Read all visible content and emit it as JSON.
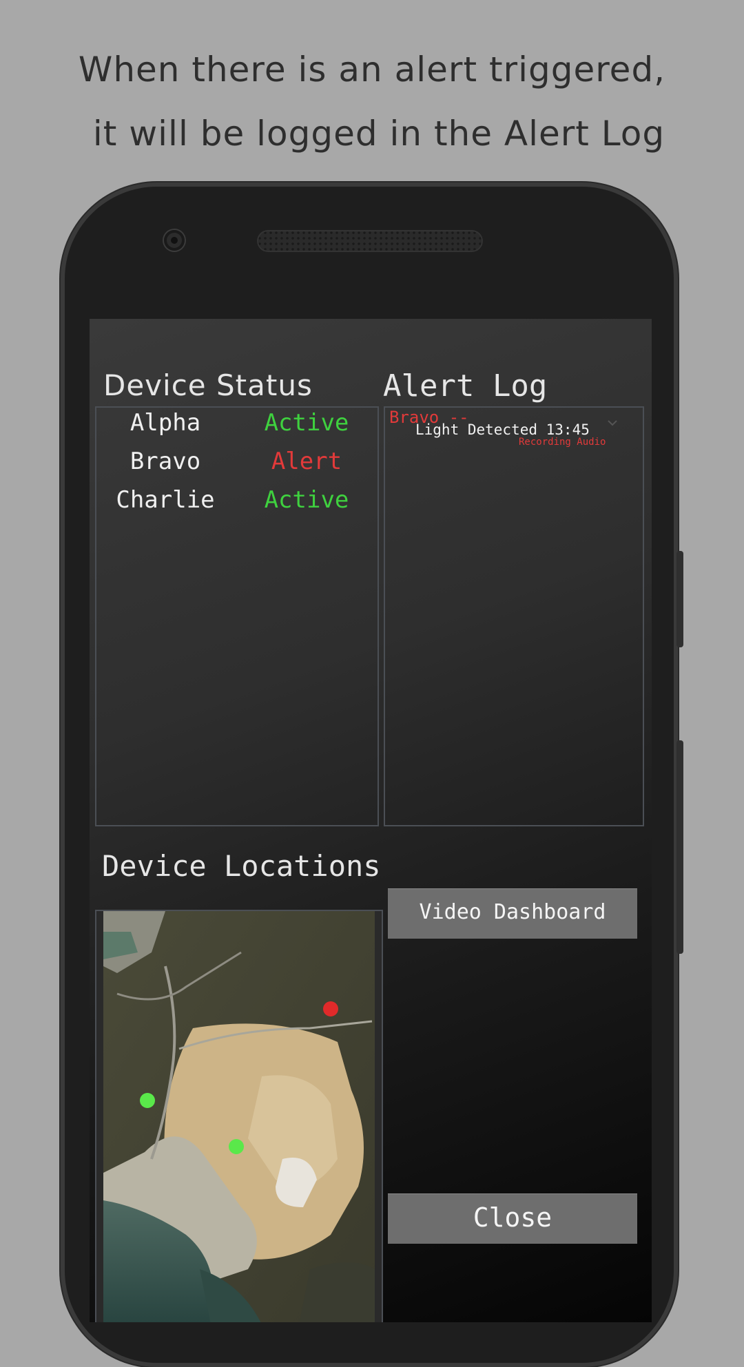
{
  "caption": {
    "line1": "When there is an alert triggered,",
    "line2": "it will be logged in the Alert Log"
  },
  "device_status": {
    "title": "Device Status",
    "devices": [
      {
        "name": "Alpha",
        "status": "Active",
        "status_color": "#3fd13f"
      },
      {
        "name": "Bravo",
        "status": "Alert",
        "status_color": "#e23a3a"
      },
      {
        "name": "Charlie",
        "status": "Active",
        "status_color": "#3fd13f"
      }
    ]
  },
  "alert_log": {
    "title": "Alert Log",
    "entries": [
      {
        "device": "Bravo --",
        "message": "Light Detected 13:45",
        "detail": "Recording Audio"
      }
    ]
  },
  "device_locations": {
    "title": "Device Locations",
    "markers": [
      {
        "color": "#e02a2a"
      },
      {
        "color": "#5ae84a"
      },
      {
        "color": "#5ae84a"
      }
    ]
  },
  "buttons": {
    "video_dashboard": "Video Dashboard",
    "close": "Close"
  },
  "colors": {
    "active": "#3fd13f",
    "alert": "#e23a3a",
    "button_bg": "#6e6e6e"
  },
  "icons": {
    "alert_expand": "chevron-down-icon",
    "camera": "front-camera-icon",
    "speaker": "earpiece-speaker-icon"
  }
}
